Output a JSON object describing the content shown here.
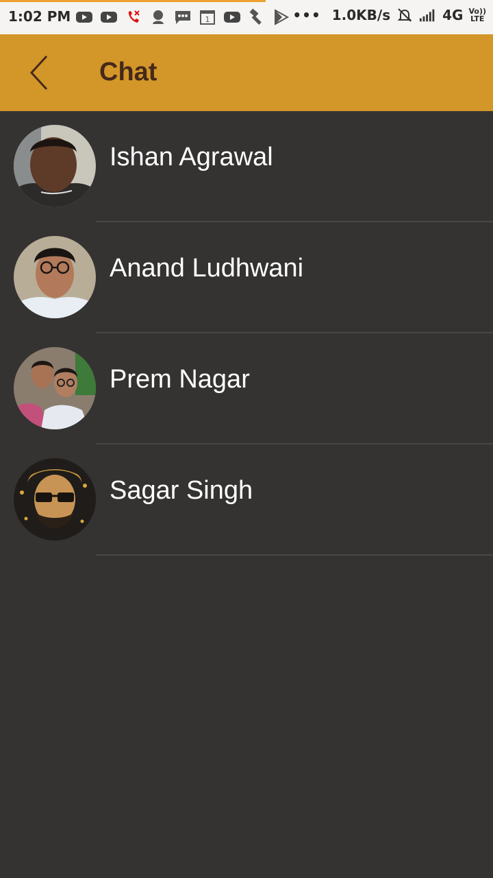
{
  "status_bar": {
    "time": "1:02 PM",
    "dots": "•••",
    "speed": "1.0KB/s",
    "network": "4G",
    "volte_top": "Vo))",
    "volte_bottom": "LTE",
    "icons": [
      "youtube-icon",
      "youtube-icon",
      "missed-call-icon",
      "user-icon",
      "message-icon",
      "calendar-icon",
      "youtube-icon",
      "hammer-icon",
      "play-store-icon",
      "mute-bell-icon",
      "signal-icon"
    ],
    "calendar_day": "1"
  },
  "app_bar": {
    "title": "Chat",
    "background": "#d39729",
    "title_color": "#46291a"
  },
  "chats": [
    {
      "name": "Ishan Agrawal"
    },
    {
      "name": "Anand Ludhwani"
    },
    {
      "name": "Prem Nagar"
    },
    {
      "name": "Sagar Singh"
    }
  ],
  "colors": {
    "list_background": "#343332",
    "divider": "#484747",
    "accent": "#d39729"
  }
}
